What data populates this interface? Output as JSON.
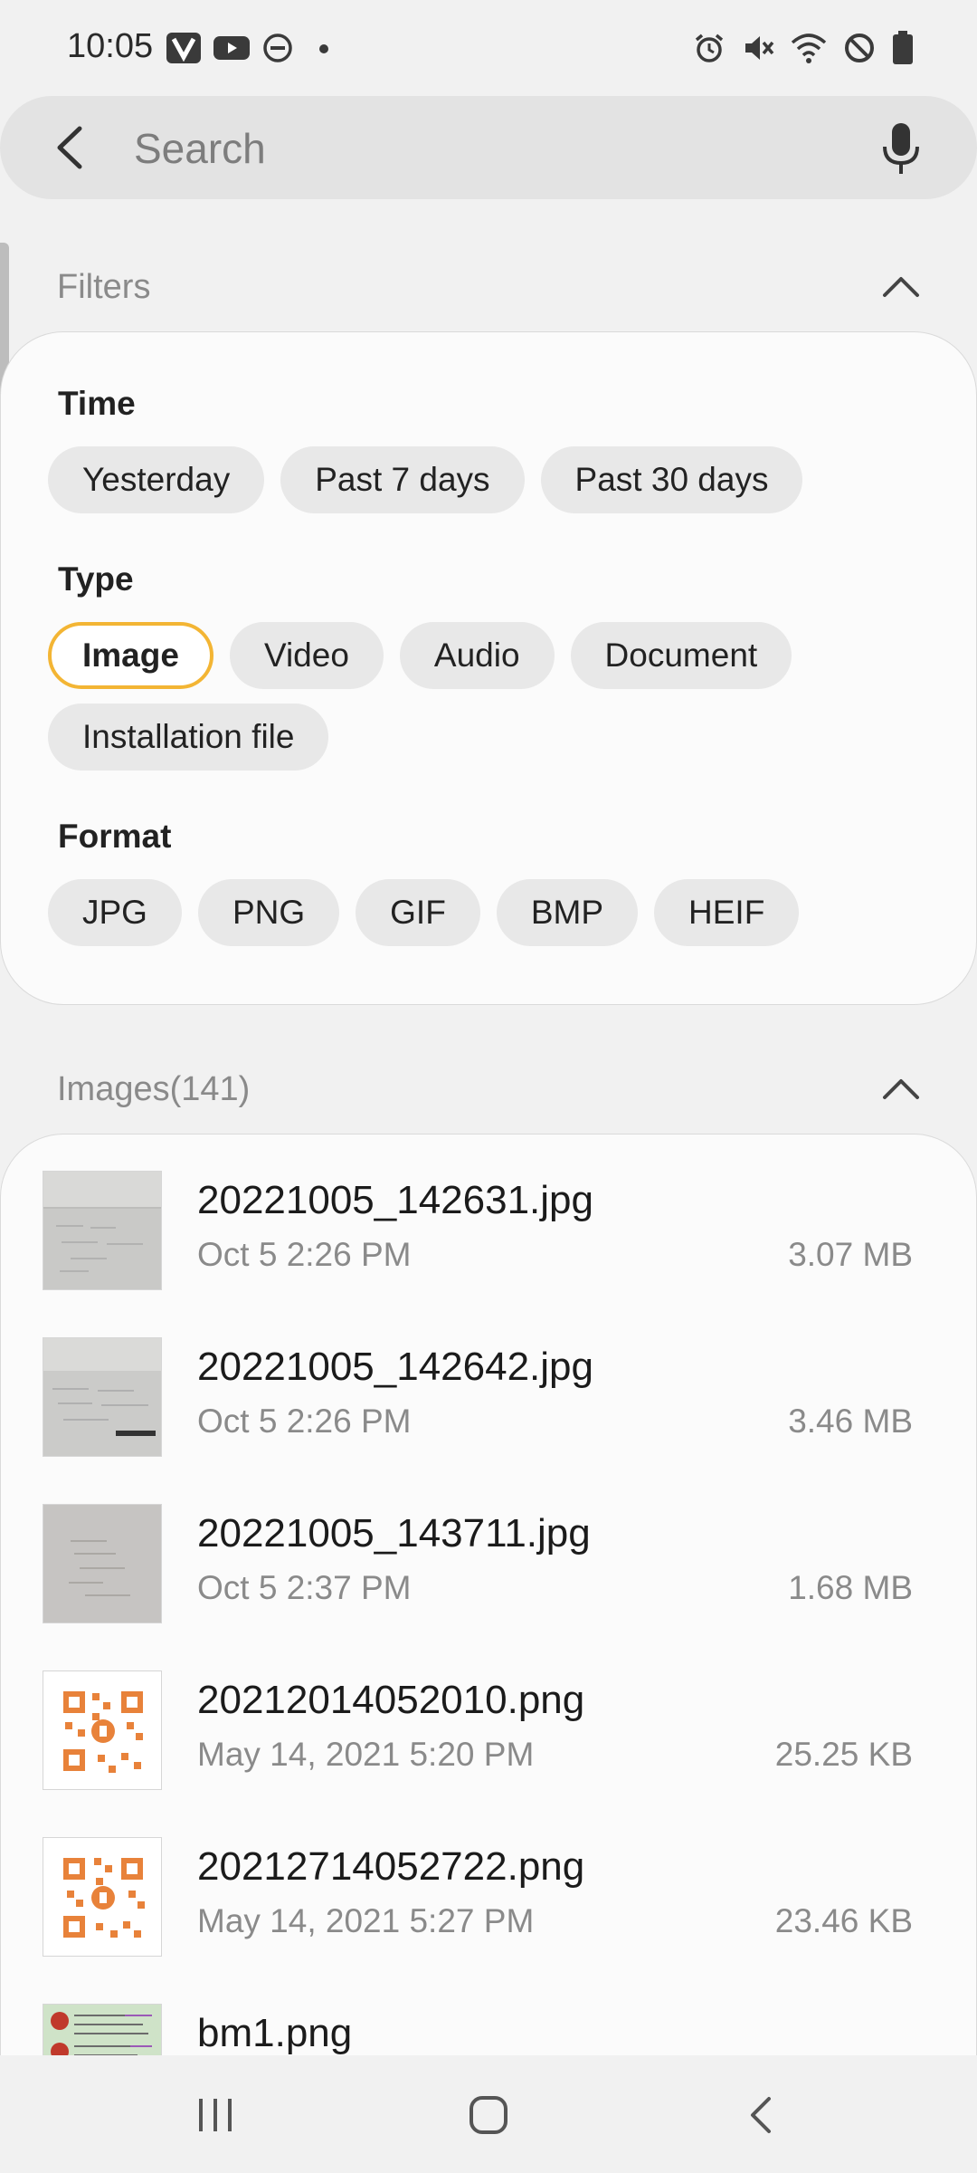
{
  "status_bar": {
    "time": "10:05",
    "left_icons": [
      "v-app-icon",
      "youtube-icon",
      "do-not-disturb-icon",
      "dot-icon"
    ],
    "right_icons": [
      "alarm-icon",
      "mute-icon",
      "wifi-icon",
      "blocked-icon",
      "battery-icon"
    ]
  },
  "search": {
    "placeholder": "Search",
    "value": ""
  },
  "filters": {
    "title": "Filters",
    "time": {
      "label": "Time",
      "options": [
        "Yesterday",
        "Past 7 days",
        "Past 30 days"
      ]
    },
    "type": {
      "label": "Type",
      "options": [
        "Image",
        "Video",
        "Audio",
        "Document",
        "Installation file"
      ],
      "selected": "Image"
    },
    "format": {
      "label": "Format",
      "options": [
        "JPG",
        "PNG",
        "GIF",
        "BMP",
        "HEIF"
      ]
    }
  },
  "images": {
    "title": "Images(141)",
    "files": [
      {
        "name": "20221005_142631.jpg",
        "date": "Oct 5 2:26 PM",
        "size": "3.07 MB",
        "thumb": "whiteboard-photo"
      },
      {
        "name": "20221005_142642.jpg",
        "date": "Oct 5 2:26 PM",
        "size": "3.46 MB",
        "thumb": "whiteboard-photo"
      },
      {
        "name": "20221005_143711.jpg",
        "date": "Oct 5 2:37 PM",
        "size": "1.68 MB",
        "thumb": "whiteboard-photo"
      },
      {
        "name": "20212014052010.png",
        "date": "May 14, 2021 5:20 PM",
        "size": "25.25 KB",
        "thumb": "qr-code"
      },
      {
        "name": "20212714052722.png",
        "date": "May 14, 2021 5:27 PM",
        "size": "23.46 KB",
        "thumb": "qr-code"
      },
      {
        "name": "bm1.png",
        "date": "",
        "size": "",
        "thumb": "document-screenshot"
      }
    ]
  },
  "colors": {
    "accent_selected": "#f3b534",
    "qr_orange": "#e8823a"
  }
}
